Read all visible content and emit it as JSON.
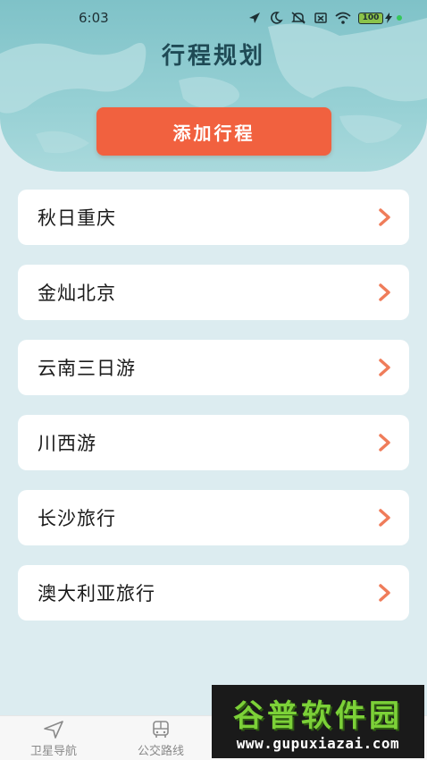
{
  "status_bar": {
    "time": "6:03",
    "battery": "100"
  },
  "header": {
    "title": "行程规划",
    "add_button_label": "添加行程"
  },
  "trips": [
    {
      "label": "秋日重庆"
    },
    {
      "label": "金灿北京"
    },
    {
      "label": "云南三日游"
    },
    {
      "label": "川西游"
    },
    {
      "label": "长沙旅行"
    },
    {
      "label": "澳大利亚旅行"
    }
  ],
  "bottom_nav": {
    "items": [
      {
        "label": "卫星导航",
        "icon": "navigation-arrow-icon"
      },
      {
        "label": "公交路线",
        "icon": "bus-icon"
      }
    ]
  },
  "watermark": {
    "title": "谷普软件园",
    "url": "www.gupuxiazai.com"
  },
  "colors": {
    "accent": "#f1613f",
    "title": "#1f4a55",
    "background": "#dcecf0",
    "chevron": "#ef7c5a"
  }
}
